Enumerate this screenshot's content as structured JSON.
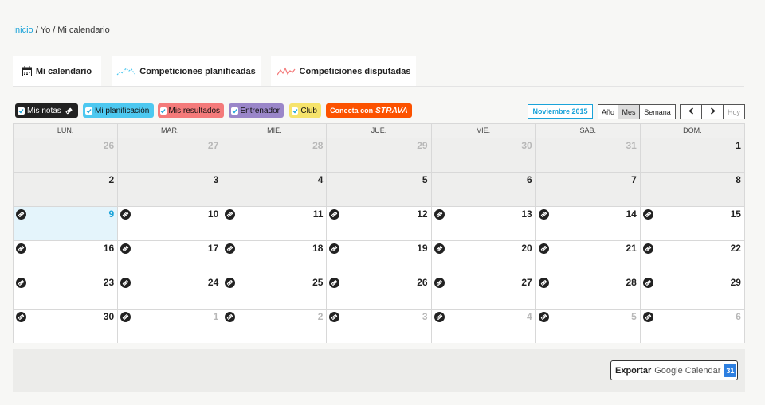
{
  "breadcrumb": {
    "home": "Inicio",
    "sep1": "/",
    "me": "Yo",
    "sep2": "/",
    "current": "Mi calendario"
  },
  "tabs": [
    {
      "label": "Mi calendario",
      "icon": "calendar-icon"
    },
    {
      "label": "Competiciones planificadas",
      "icon": "planned-line-icon"
    },
    {
      "label": "Competiciones disputadas",
      "icon": "completed-line-icon"
    }
  ],
  "filters": [
    {
      "label": "Mis notas",
      "color": "#222222",
      "text_color": "#ffffff",
      "checked": true,
      "icon": "note-tag-icon"
    },
    {
      "label": "Mi planificación",
      "color": "#4dc8f0",
      "text_color": "#111111",
      "checked": true
    },
    {
      "label": "Mis resultados",
      "color": "#f47a7a",
      "text_color": "#111111",
      "checked": true
    },
    {
      "label": "Entrenador",
      "color": "#9a86c9",
      "text_color": "#111111",
      "checked": true
    },
    {
      "label": "Club",
      "color": "#f6e36b",
      "text_color": "#111111",
      "checked": true
    }
  ],
  "strava": {
    "label": "Conecta con",
    "brand": "STRAVA",
    "color": "#fc5200"
  },
  "month_label": "Noviembre 2015",
  "view_buttons": [
    "Año",
    "Mes",
    "Semana"
  ],
  "active_view": "Mes",
  "nav": {
    "prev": "‹",
    "next": "›",
    "today": "Hoy"
  },
  "weekdays": [
    "LUN.",
    "MAR.",
    "MIÉ.",
    "JUE.",
    "VIE.",
    "SÁB.",
    "DOM."
  ],
  "weeks": [
    [
      {
        "n": "26",
        "state": "past-other"
      },
      {
        "n": "27",
        "state": "past-other"
      },
      {
        "n": "28",
        "state": "past-other"
      },
      {
        "n": "29",
        "state": "past-other"
      },
      {
        "n": "30",
        "state": "past-other"
      },
      {
        "n": "31",
        "state": "past-other"
      },
      {
        "n": "1",
        "state": "past"
      }
    ],
    [
      {
        "n": "2",
        "state": "past"
      },
      {
        "n": "3",
        "state": "past"
      },
      {
        "n": "4",
        "state": "past"
      },
      {
        "n": "5",
        "state": "past"
      },
      {
        "n": "6",
        "state": "past"
      },
      {
        "n": "7",
        "state": "past"
      },
      {
        "n": "8",
        "state": "past"
      }
    ],
    [
      {
        "n": "9",
        "state": "today",
        "note": true
      },
      {
        "n": "10",
        "state": "future",
        "note": true
      },
      {
        "n": "11",
        "state": "future",
        "note": true
      },
      {
        "n": "12",
        "state": "future",
        "note": true
      },
      {
        "n": "13",
        "state": "future",
        "note": true
      },
      {
        "n": "14",
        "state": "future",
        "note": true
      },
      {
        "n": "15",
        "state": "future",
        "note": true
      }
    ],
    [
      {
        "n": "16",
        "state": "future",
        "note": true
      },
      {
        "n": "17",
        "state": "future",
        "note": true
      },
      {
        "n": "18",
        "state": "future",
        "note": true
      },
      {
        "n": "19",
        "state": "future",
        "note": true
      },
      {
        "n": "20",
        "state": "future",
        "note": true
      },
      {
        "n": "21",
        "state": "future",
        "note": true
      },
      {
        "n": "22",
        "state": "future",
        "note": true
      }
    ],
    [
      {
        "n": "23",
        "state": "future",
        "note": true
      },
      {
        "n": "24",
        "state": "future",
        "note": true
      },
      {
        "n": "25",
        "state": "future",
        "note": true
      },
      {
        "n": "26",
        "state": "future",
        "note": true
      },
      {
        "n": "27",
        "state": "future",
        "note": true
      },
      {
        "n": "28",
        "state": "future",
        "note": true
      },
      {
        "n": "29",
        "state": "future",
        "note": true
      }
    ],
    [
      {
        "n": "30",
        "state": "future",
        "note": true
      },
      {
        "n": "1",
        "state": "future-other",
        "note": true
      },
      {
        "n": "2",
        "state": "future-other",
        "note": true
      },
      {
        "n": "3",
        "state": "future-other",
        "note": true
      },
      {
        "n": "4",
        "state": "future-other",
        "note": true
      },
      {
        "n": "5",
        "state": "future-other",
        "note": true
      },
      {
        "n": "6",
        "state": "future-other",
        "note": true
      }
    ]
  ],
  "export": {
    "prefix": "Exportar",
    "service": "Google Calendar",
    "badge": "31",
    "icon": "google-calendar-icon"
  },
  "colors": {
    "accent": "#1aa3d9"
  }
}
